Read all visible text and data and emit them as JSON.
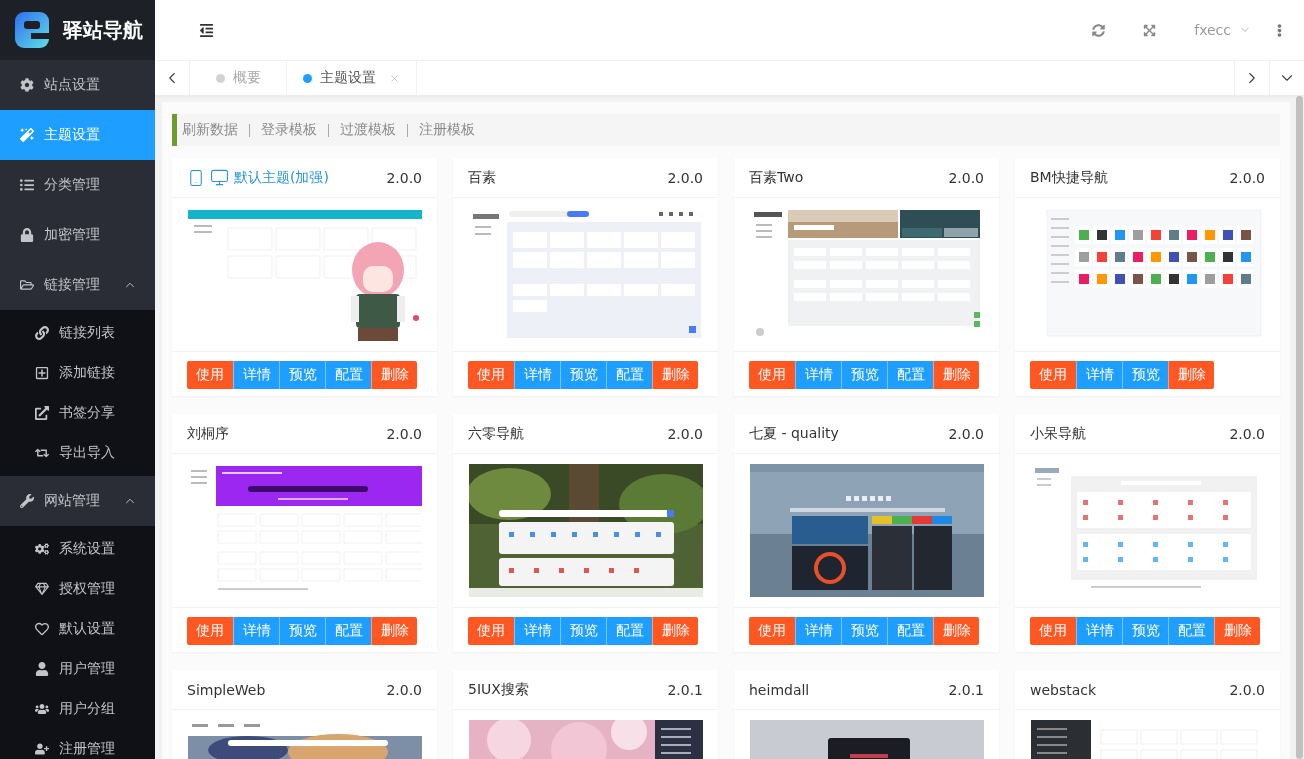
{
  "sidebar": {
    "brand": "驿站导航",
    "items": [
      {
        "label": "站点设置",
        "selected": false
      },
      {
        "label": "主题设置",
        "selected": true
      },
      {
        "label": "分类管理",
        "selected": false
      },
      {
        "label": "加密管理",
        "selected": false
      },
      {
        "label": "链接管理",
        "selected": false,
        "expanded": true,
        "children": [
          {
            "label": "链接列表",
            "selected": false
          },
          {
            "label": "添加链接",
            "selected": false
          },
          {
            "label": "书签分享",
            "selected": false
          },
          {
            "label": "导出导入",
            "selected": false
          }
        ]
      },
      {
        "label": "网站管理",
        "selected": false,
        "expanded": true,
        "children": [
          {
            "label": "系统设置",
            "selected": false
          },
          {
            "label": "授权管理",
            "selected": false
          },
          {
            "label": "默认设置",
            "selected": false
          },
          {
            "label": "用户管理",
            "selected": false
          },
          {
            "label": "用户分组",
            "selected": false
          },
          {
            "label": "注册管理",
            "selected": false
          }
        ]
      }
    ]
  },
  "header": {
    "user": "fxecc"
  },
  "tabs": [
    {
      "label": "概要",
      "selected": false,
      "closable": false
    },
    {
      "label": "主题设置",
      "selected": true,
      "closable": true
    }
  ],
  "toolbar": {
    "links": [
      "刷新数据",
      "登录模板",
      "过渡模板",
      "注册模板"
    ]
  },
  "themes": [
    {
      "name": "默认主题(加强)",
      "version": "2.0.0",
      "current": true,
      "preview": {
        "kind": "banner"
      },
      "buttons": [
        {
          "label": "使用",
          "kind": "use"
        },
        {
          "label": "详情",
          "kind": "details"
        },
        {
          "label": "预览",
          "kind": "preview"
        },
        {
          "label": "配置",
          "kind": "config"
        },
        {
          "label": "删除",
          "kind": "delete"
        }
      ]
    },
    {
      "name": "百素",
      "version": "2.0.0",
      "current": false,
      "preview": {
        "kind": "sidebar"
      },
      "buttons": [
        {
          "label": "使用",
          "kind": "use"
        },
        {
          "label": "详情",
          "kind": "details"
        },
        {
          "label": "预览",
          "kind": "preview"
        },
        {
          "label": "配置",
          "kind": "config"
        },
        {
          "label": "删除",
          "kind": "delete"
        }
      ]
    },
    {
      "name": "百素Two",
      "version": "2.0.0",
      "current": false,
      "preview": {
        "kind": "hero"
      },
      "buttons": [
        {
          "label": "使用",
          "kind": "use"
        },
        {
          "label": "详情",
          "kind": "details"
        },
        {
          "label": "预览",
          "kind": "preview"
        },
        {
          "label": "配置",
          "kind": "config"
        },
        {
          "label": "删除",
          "kind": "delete"
        }
      ]
    },
    {
      "name": "BM快捷导航",
      "version": "2.0.0",
      "current": false,
      "preview": {
        "kind": "grid"
      },
      "buttons": [
        {
          "label": "使用",
          "kind": "use"
        },
        {
          "label": "详情",
          "kind": "details"
        },
        {
          "label": "预览",
          "kind": "preview"
        },
        {
          "label": "删除",
          "kind": "delete"
        }
      ]
    },
    {
      "name": "刘桐序",
      "version": "2.0.0",
      "current": false,
      "preview": {
        "kind": "purple"
      },
      "buttons": [
        {
          "label": "使用",
          "kind": "use"
        },
        {
          "label": "详情",
          "kind": "details"
        },
        {
          "label": "预览",
          "kind": "preview"
        },
        {
          "label": "配置",
          "kind": "config"
        },
        {
          "label": "删除",
          "kind": "delete"
        }
      ]
    },
    {
      "name": "六零导航",
      "version": "2.0.0",
      "current": false,
      "preview": {
        "kind": "forest"
      },
      "buttons": [
        {
          "label": "使用",
          "kind": "use"
        },
        {
          "label": "详情",
          "kind": "details"
        },
        {
          "label": "预览",
          "kind": "preview"
        },
        {
          "label": "配置",
          "kind": "config"
        },
        {
          "label": "删除",
          "kind": "delete"
        }
      ]
    },
    {
      "name": "七夏 - quality",
      "version": "2.0.0",
      "current": false,
      "preview": {
        "kind": "sea"
      },
      "buttons": [
        {
          "label": "使用",
          "kind": "use"
        },
        {
          "label": "详情",
          "kind": "details"
        },
        {
          "label": "预览",
          "kind": "preview"
        },
        {
          "label": "配置",
          "kind": "config"
        },
        {
          "label": "删除",
          "kind": "delete"
        }
      ]
    },
    {
      "name": "小呆导航",
      "version": "2.0.0",
      "current": false,
      "preview": {
        "kind": "plain"
      },
      "buttons": [
        {
          "label": "使用",
          "kind": "use"
        },
        {
          "label": "详情",
          "kind": "details"
        },
        {
          "label": "预览",
          "kind": "preview"
        },
        {
          "label": "配置",
          "kind": "config"
        },
        {
          "label": "删除",
          "kind": "delete"
        }
      ]
    },
    {
      "name": "SimpleWeb",
      "version": "2.0.0",
      "current": false,
      "preview": {
        "kind": "photo"
      }
    },
    {
      "name": "5IUX搜索",
      "version": "2.0.1",
      "current": false,
      "preview": {
        "kind": "pink"
      }
    },
    {
      "name": "heimdall",
      "version": "2.0.1",
      "current": false,
      "preview": {
        "kind": "dark"
      }
    },
    {
      "name": "webstack",
      "version": "2.0.0",
      "current": false,
      "preview": {
        "kind": "split"
      }
    }
  ]
}
